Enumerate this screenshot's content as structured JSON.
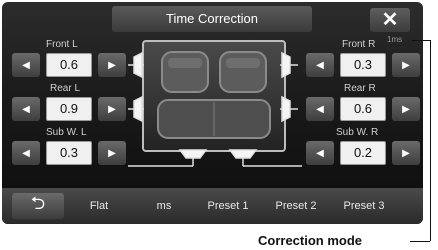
{
  "window": {
    "title": "Time Correction",
    "close_label": "✕",
    "unit_label": "1ms"
  },
  "channels": {
    "front_l": {
      "label": "Front L",
      "value": "0.6"
    },
    "front_r": {
      "label": "Front R",
      "value": "0.3"
    },
    "rear_l": {
      "label": "Rear L",
      "value": "0.9"
    },
    "rear_r": {
      "label": "Rear R",
      "value": "0.6"
    },
    "sub_l": {
      "label": "Sub W. L",
      "value": "0.3"
    },
    "sub_r": {
      "label": "Sub W. R",
      "value": "0.2"
    }
  },
  "arrows": {
    "left": "◀",
    "right": "▶"
  },
  "bottombar": {
    "back_label": "⮌",
    "items": [
      "Flat",
      "ms",
      "Preset 1",
      "Preset 2",
      "Preset 3"
    ]
  },
  "annotation": "Correction mode"
}
